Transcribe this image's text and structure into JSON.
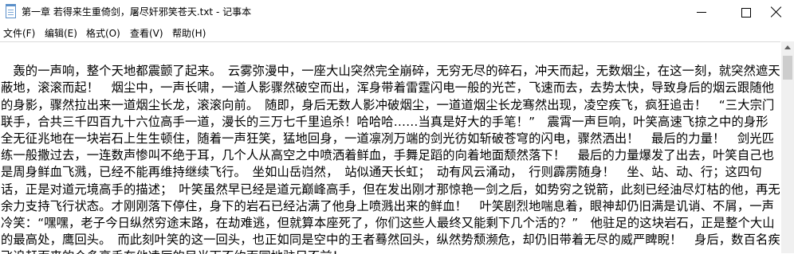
{
  "window": {
    "title": "第一章 若得来生重倚剑，屠尽奸邪笑苍天.txt - 记事本",
    "icon": "notepad-icon"
  },
  "controls": {
    "minimize": "minimize-icon",
    "maximize": "maximize-icon",
    "close": "close-icon"
  },
  "menu": {
    "file": "文件(F)",
    "edit": "编辑(E)",
    "format": "格式(O)",
    "view": "查看(V)",
    "help": "帮助(H)"
  },
  "document": {
    "text": "\n　轰的一声响，整个天地都震颤了起来。　云雾弥漫中，一座大山突然完全崩碎，无穷无尽的碎石，冲天而起，无数烟尘，在这一刻，就突然遮天蔽地，滚滚而起！　烟尘中，一声长啸，一道人影骤然破空而出，浑身带着雷霆闪电一般的光芒，飞速而去，去势太快，导致身后的烟云跟随他的身影，骤然拉出来一道烟尘长龙，滚滚向前。　随即，身后无数人影冲破烟尘，一道道烟尘长龙骞然出现，凌空疾飞，疯狂追击！　“三大宗门联手，合共三千四百九十六位高手一道，漫长的三万七千里追杀！哈哈哈……当真是好大的手笔！”　震霄一声巨响，叶笑高速飞掠之中的身形全无征兆地在一块岩石上生生顿住，随着一声狂笑，猛地回身，一道凛冽万端的剑光彷如斩破苍穹的闪电，骤然洒出！　最后的力量！　剑光匹练一般撒过去，一连数声惨叫不绝于耳，几个人从高空之中喷洒着鲜血，手舞足蹈的向着地面颓然落下！　最后的力量爆发了出去，叶笑自己也是周身鲜血飞溅，已经不能再维持继续飞行。　坐如山岳岿然，　站似通天长虹；　动有风云涌动，　行则霹雳随身！　坐、站、动、行；这四句话，正是对道元境高手的描述；　叶笑虽然早已经是道元巅峰高手，但在发出刚才那惊艳一剑之后，如势穷之锐箭，此刻已经油尽灯枯的他，再无余力支持飞行状态。才刚刚落下停住，身下的岩石已经沾满了他身上喷溅出来的鲜血！　叶笑剧烈地喘息着，眼神却仍旧满是讥诮、不屑，一声冷笑：“嘿嘿，老子今日纵然穷途末路，在劫难逃，但就算本座死了，你们这些人最终又能剩下几个活的？”　他驻足的这块岩石，正是整个大山的最高处，鹰回头。　而此刻叶笑的这一回头，也正如同是空中的王者蓦然回头，纵然势颓濒危，却仍旧带着无尽的威严睥睨！　身后，数百名疾飞追赶而来的众多高手在他凌厉的目光下不约而同地驻足不前！"
  }
}
